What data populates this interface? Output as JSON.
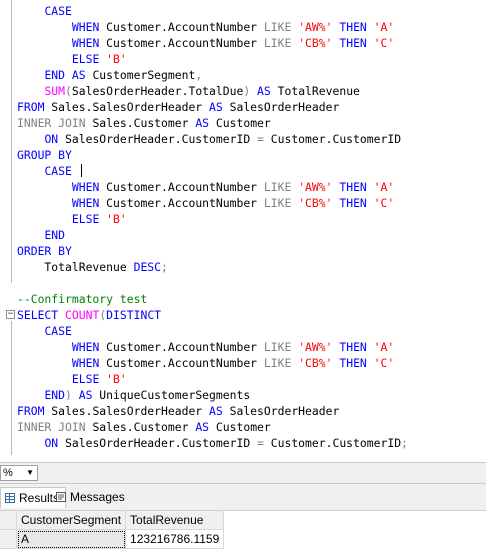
{
  "editor": {
    "lines": [
      [
        {
          "t": "    "
        },
        {
          "t": "CASE",
          "c": "kw"
        }
      ],
      [
        {
          "t": "        "
        },
        {
          "t": "WHEN",
          "c": "kw"
        },
        {
          "t": " Customer.AccountNumber "
        },
        {
          "t": "LIKE",
          "c": "gr"
        },
        {
          "t": " "
        },
        {
          "t": "'AW%'",
          "c": "str"
        },
        {
          "t": " "
        },
        {
          "t": "THEN",
          "c": "kw"
        },
        {
          "t": " "
        },
        {
          "t": "'A'",
          "c": "str"
        }
      ],
      [
        {
          "t": "        "
        },
        {
          "t": "WHEN",
          "c": "kw"
        },
        {
          "t": " Customer.AccountNumber "
        },
        {
          "t": "LIKE",
          "c": "gr"
        },
        {
          "t": " "
        },
        {
          "t": "'CB%'",
          "c": "str"
        },
        {
          "t": " "
        },
        {
          "t": "THEN",
          "c": "kw"
        },
        {
          "t": " "
        },
        {
          "t": "'C'",
          "c": "str"
        }
      ],
      [
        {
          "t": "        "
        },
        {
          "t": "ELSE",
          "c": "kw"
        },
        {
          "t": " "
        },
        {
          "t": "'B'",
          "c": "str"
        }
      ],
      [
        {
          "t": "    "
        },
        {
          "t": "END",
          "c": "kw"
        },
        {
          "t": " "
        },
        {
          "t": "AS",
          "c": "kw"
        },
        {
          "t": " CustomerSegment"
        },
        {
          "t": ",",
          "c": "gr"
        }
      ],
      [
        {
          "t": "    "
        },
        {
          "t": "SUM",
          "c": "fn"
        },
        {
          "t": "(",
          "c": "gr"
        },
        {
          "t": "SalesOrderHeader.TotalDue"
        },
        {
          "t": ")",
          "c": "gr"
        },
        {
          "t": " "
        },
        {
          "t": "AS",
          "c": "kw"
        },
        {
          "t": " TotalRevenue"
        }
      ],
      [
        {
          "t": "FROM",
          "c": "kw"
        },
        {
          "t": " Sales.SalesOrderHeader "
        },
        {
          "t": "AS",
          "c": "kw"
        },
        {
          "t": " SalesOrderHeader"
        }
      ],
      [
        {
          "t": "INNER",
          "c": "gr"
        },
        {
          "t": " "
        },
        {
          "t": "JOIN",
          "c": "gr"
        },
        {
          "t": " Sales.Customer "
        },
        {
          "t": "AS",
          "c": "kw"
        },
        {
          "t": " Customer"
        }
      ],
      [
        {
          "t": "    "
        },
        {
          "t": "ON",
          "c": "kw"
        },
        {
          "t": " SalesOrderHeader.CustomerID "
        },
        {
          "t": "=",
          "c": "gr"
        },
        {
          "t": " Customer.CustomerID"
        }
      ],
      [
        {
          "t": "GROUP",
          "c": "kw"
        },
        {
          "t": " "
        },
        {
          "t": "BY",
          "c": "kw"
        }
      ],
      [
        {
          "t": "    "
        },
        {
          "t": "CASE",
          "c": "kw"
        },
        {
          "t": " "
        },
        {
          "caret": true
        }
      ],
      [
        {
          "t": "        "
        },
        {
          "t": "WHEN",
          "c": "kw"
        },
        {
          "t": " Customer.AccountNumber "
        },
        {
          "t": "LIKE",
          "c": "gr"
        },
        {
          "t": " "
        },
        {
          "t": "'AW%'",
          "c": "str"
        },
        {
          "t": " "
        },
        {
          "t": "THEN",
          "c": "kw"
        },
        {
          "t": " "
        },
        {
          "t": "'A'",
          "c": "str"
        }
      ],
      [
        {
          "t": "        "
        },
        {
          "t": "WHEN",
          "c": "kw"
        },
        {
          "t": " Customer.AccountNumber "
        },
        {
          "t": "LIKE",
          "c": "gr"
        },
        {
          "t": " "
        },
        {
          "t": "'CB%'",
          "c": "str"
        },
        {
          "t": " "
        },
        {
          "t": "THEN",
          "c": "kw"
        },
        {
          "t": " "
        },
        {
          "t": "'C'",
          "c": "str"
        }
      ],
      [
        {
          "t": "        "
        },
        {
          "t": "ELSE",
          "c": "kw"
        },
        {
          "t": " "
        },
        {
          "t": "'B'",
          "c": "str"
        }
      ],
      [
        {
          "t": "    "
        },
        {
          "t": "END",
          "c": "kw"
        }
      ],
      [
        {
          "t": "ORDER",
          "c": "kw"
        },
        {
          "t": " "
        },
        {
          "t": "BY",
          "c": "kw"
        }
      ],
      [
        {
          "t": "    TotalRevenue "
        },
        {
          "t": "DESC",
          "c": "kw"
        },
        {
          "t": ";",
          "c": "gr"
        }
      ],
      [],
      [
        {
          "t": "--Confirmatory test",
          "c": "cm"
        }
      ],
      [
        {
          "t": "SELECT",
          "c": "kw"
        },
        {
          "t": " "
        },
        {
          "t": "COUNT",
          "c": "fn"
        },
        {
          "t": "(",
          "c": "gr"
        },
        {
          "t": "DISTINCT",
          "c": "kw"
        }
      ],
      [
        {
          "t": "    "
        },
        {
          "t": "CASE",
          "c": "kw"
        }
      ],
      [
        {
          "t": "        "
        },
        {
          "t": "WHEN",
          "c": "kw"
        },
        {
          "t": " Customer.AccountNumber "
        },
        {
          "t": "LIKE",
          "c": "gr"
        },
        {
          "t": " "
        },
        {
          "t": "'AW%'",
          "c": "str"
        },
        {
          "t": " "
        },
        {
          "t": "THEN",
          "c": "kw"
        },
        {
          "t": " "
        },
        {
          "t": "'A'",
          "c": "str"
        }
      ],
      [
        {
          "t": "        "
        },
        {
          "t": "WHEN",
          "c": "kw"
        },
        {
          "t": " Customer.AccountNumber "
        },
        {
          "t": "LIKE",
          "c": "gr"
        },
        {
          "t": " "
        },
        {
          "t": "'CB%'",
          "c": "str"
        },
        {
          "t": " "
        },
        {
          "t": "THEN",
          "c": "kw"
        },
        {
          "t": " "
        },
        {
          "t": "'C'",
          "c": "str"
        }
      ],
      [
        {
          "t": "        "
        },
        {
          "t": "ELSE",
          "c": "kw"
        },
        {
          "t": " "
        },
        {
          "t": "'B'",
          "c": "str"
        }
      ],
      [
        {
          "t": "    "
        },
        {
          "t": "END",
          "c": "kw"
        },
        {
          "t": ")",
          "c": "gr"
        },
        {
          "t": " "
        },
        {
          "t": "AS",
          "c": "kw"
        },
        {
          "t": " UniqueCustomerSegments"
        }
      ],
      [
        {
          "t": "FROM",
          "c": "kw"
        },
        {
          "t": " Sales.SalesOrderHeader "
        },
        {
          "t": "AS",
          "c": "kw"
        },
        {
          "t": " SalesOrderHeader"
        }
      ],
      [
        {
          "t": "INNER",
          "c": "gr"
        },
        {
          "t": " "
        },
        {
          "t": "JOIN",
          "c": "gr"
        },
        {
          "t": " Sales.Customer "
        },
        {
          "t": "AS",
          "c": "kw"
        },
        {
          "t": " Customer"
        }
      ],
      [
        {
          "t": "    "
        },
        {
          "t": "ON",
          "c": "kw"
        },
        {
          "t": " SalesOrderHeader.CustomerID "
        },
        {
          "t": "=",
          "c": "gr"
        },
        {
          "t": " Customer.CustomerID"
        },
        {
          "t": ";",
          "c": "gr"
        }
      ]
    ],
    "collapse_glyph": "−"
  },
  "zoom": {
    "value": "%",
    "arrow": "▼"
  },
  "tabs": {
    "results_label": "Results",
    "messages_label": "Messages"
  },
  "results": {
    "columns": [
      "CustomerSegment",
      "TotalRevenue"
    ],
    "rows": [
      [
        "A",
        "123216786.1159"
      ]
    ]
  },
  "colors": {
    "keyword": "#0000ff",
    "function": "#ff00ff",
    "string": "#ff0000",
    "operator": "#808080",
    "comment": "#008000"
  }
}
